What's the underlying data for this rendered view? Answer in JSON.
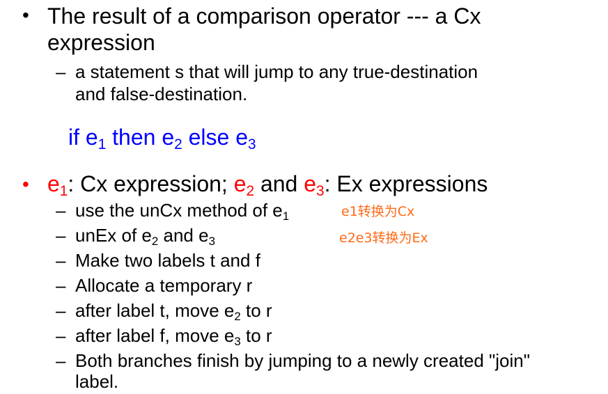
{
  "bullet1": {
    "bullet": "•",
    "line1": "The result of a comparison operator --- a Cx",
    "line2": "expression",
    "sub": {
      "dash": "–",
      "line1": "a statement s that will jump to any true-destination",
      "line2": "and false-destination."
    }
  },
  "code": {
    "kw_if": "if e",
    "s1": "1",
    "kw_then": " then e",
    "s2": "2",
    "kw_else": " else e",
    "s3": "3"
  },
  "bullet2": {
    "bullet": "•",
    "e1": "e",
    "e1_sub": "1",
    "t1": ": Cx expression; ",
    "e2": "e",
    "e2_sub": "2",
    "t2": " and ",
    "e3": "e",
    "e3_sub": "3",
    "t3": ": Ex expressions"
  },
  "steps": [
    {
      "dash": "–",
      "text": "use the unCx method of e",
      "sub": "1",
      "after": ""
    },
    {
      "dash": "–",
      "text": "unEx of e",
      "sub": "2",
      "after": " and e",
      "sub2": "3"
    },
    {
      "dash": "–",
      "text": "Make two labels t and f"
    },
    {
      "dash": "–",
      "text": "Allocate a temporary r"
    },
    {
      "dash": "–",
      "text": "after label t, move e",
      "sub": "2",
      "after": " to r"
    },
    {
      "dash": "–",
      "text": "after label f, move e",
      "sub": "3",
      "after": " to r"
    },
    {
      "dash": "–",
      "text": "Both branches finish by jumping to a newly created \"join\"",
      "line2": "label."
    }
  ],
  "annotations": {
    "note1": "e1转换为Cx",
    "note2": "e2e3转换为Ex"
  },
  "colors": {
    "accent_red": "#ff0000",
    "code_blue": "#0000ff",
    "note_orange": "#ff6a17"
  }
}
